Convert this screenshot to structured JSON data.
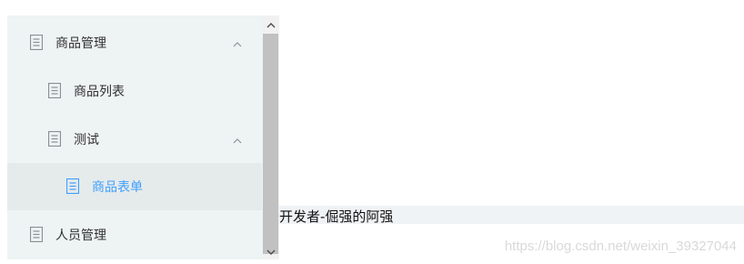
{
  "sidebar": {
    "items": [
      {
        "label": "商品管理",
        "icon": "document-icon",
        "expanded": true
      },
      {
        "label": "商品列表",
        "icon": "document-icon"
      },
      {
        "label": "测试",
        "icon": "document-icon",
        "expanded": true
      },
      {
        "label": "商品表单",
        "icon": "document-icon",
        "active": true
      },
      {
        "label": "人员管理",
        "icon": "document-icon"
      }
    ]
  },
  "content": {
    "text": "开发者-倔强的阿强"
  },
  "watermark": "https://blog.csdn.net/weixin_39327044",
  "colors": {
    "active_text": "#409eff",
    "sidebar_bg": "#eef3f3",
    "icon_gray": "#8a8f95"
  }
}
